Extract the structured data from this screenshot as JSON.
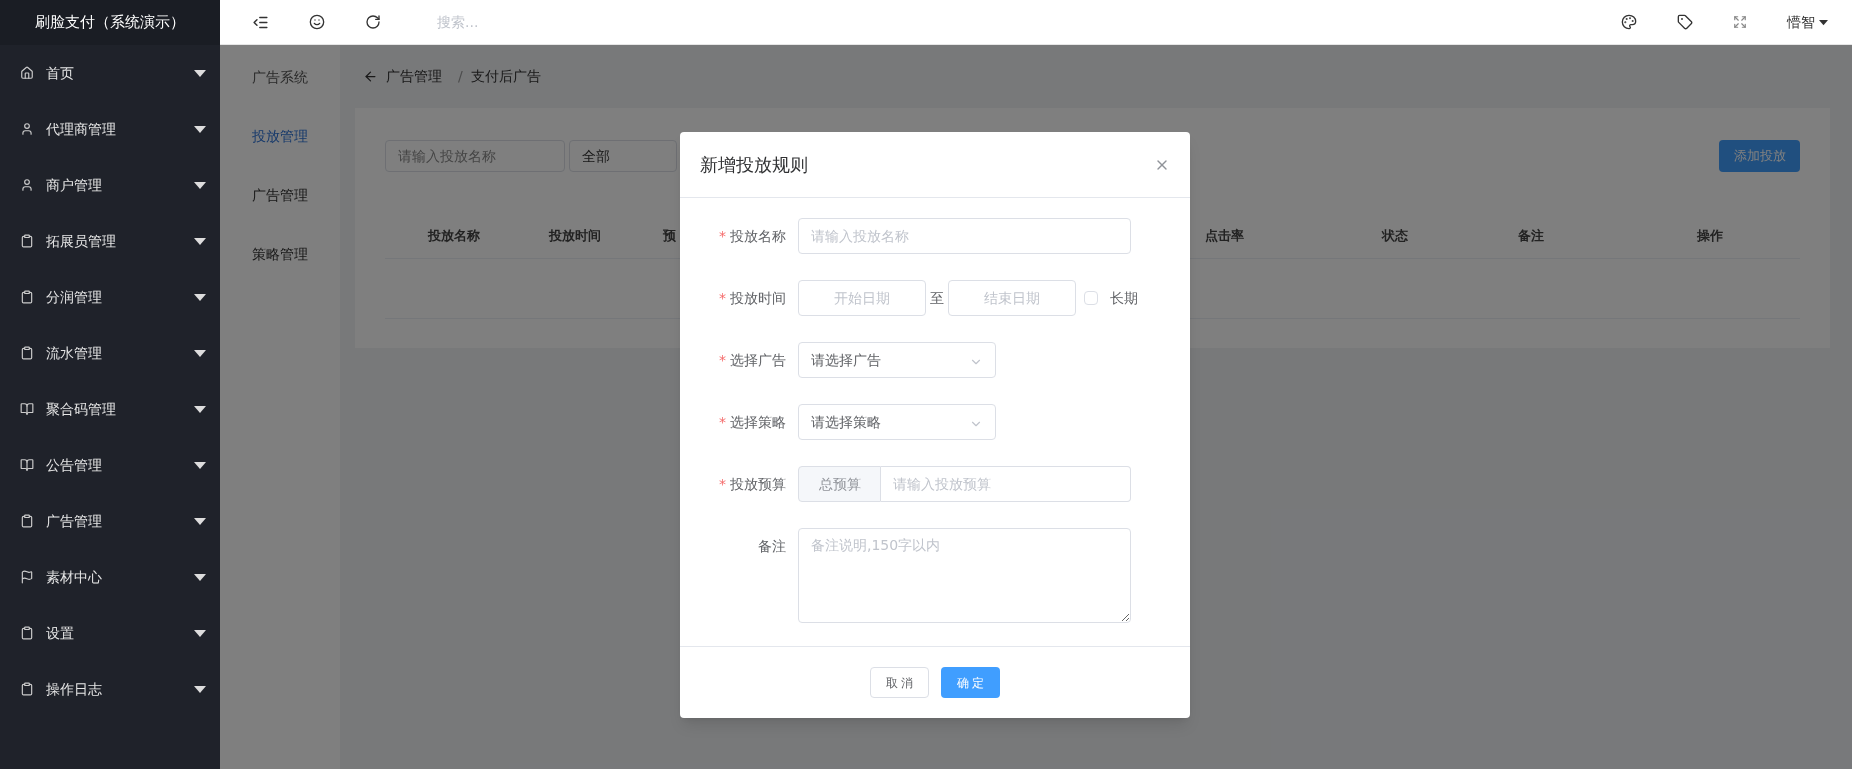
{
  "app_title": "刷脸支付（系统演示）",
  "topbar": {
    "search_placeholder": "搜索...",
    "user": "懵智"
  },
  "sidebar": {
    "items": [
      {
        "label": "首页",
        "kind": "home"
      },
      {
        "label": "代理商管理",
        "kind": "user"
      },
      {
        "label": "商户管理",
        "kind": "user"
      },
      {
        "label": "拓展员管理",
        "kind": "clipboard"
      },
      {
        "label": "分润管理",
        "kind": "clipboard"
      },
      {
        "label": "流水管理",
        "kind": "clipboard"
      },
      {
        "label": "聚合码管理",
        "kind": "book"
      },
      {
        "label": "公告管理",
        "kind": "book"
      },
      {
        "label": "广告管理",
        "kind": "clipboard"
      },
      {
        "label": "素材中心",
        "kind": "flag"
      },
      {
        "label": "设置",
        "kind": "clipboard"
      },
      {
        "label": "操作日志",
        "kind": "clipboard"
      }
    ]
  },
  "subnav": {
    "title": "广告系统",
    "items": [
      {
        "label": "投放管理",
        "selected": true
      },
      {
        "label": "广告管理",
        "selected": false
      },
      {
        "label": "策略管理",
        "selected": false
      }
    ]
  },
  "breadcrumb": {
    "items": [
      "广告管理",
      "支付后广告"
    ],
    "separator": "/"
  },
  "filters": {
    "name_placeholder": "请输入投放名称",
    "status_value": "全部"
  },
  "add_button": "添加投放",
  "table": {
    "columns": [
      {
        "label": "投放名称"
      },
      {
        "label": "投放时间"
      },
      {
        "label": "预"
      },
      {
        "label": "点击率"
      },
      {
        "label": "状态"
      },
      {
        "label": "备注"
      },
      {
        "label": "操作"
      }
    ]
  },
  "modal": {
    "title": "新增投放规则",
    "required_mark": "*",
    "fields": [
      {
        "kind": "text",
        "label": "投放名称",
        "required": true,
        "placeholder": "请输入投放名称"
      },
      {
        "kind": "daterange",
        "label": "投放时间",
        "required": true,
        "start_placeholder": "开始日期",
        "separator": "至",
        "end_placeholder": "结束日期",
        "checkbox_label": "长期",
        "checked": false
      },
      {
        "kind": "select",
        "label": "选择广告",
        "required": true,
        "value": "请选择广告"
      },
      {
        "kind": "select",
        "label": "选择策略",
        "required": true,
        "value": "请选择策略"
      },
      {
        "kind": "budget",
        "label": "投放预算",
        "required": true,
        "prefix": "总预算",
        "placeholder": "请输入投放预算"
      },
      {
        "kind": "textarea",
        "label": "备注",
        "required": false,
        "placeholder": "备注说明,150字以内"
      }
    ],
    "cancel": "取 消",
    "confirm": "确 定"
  }
}
